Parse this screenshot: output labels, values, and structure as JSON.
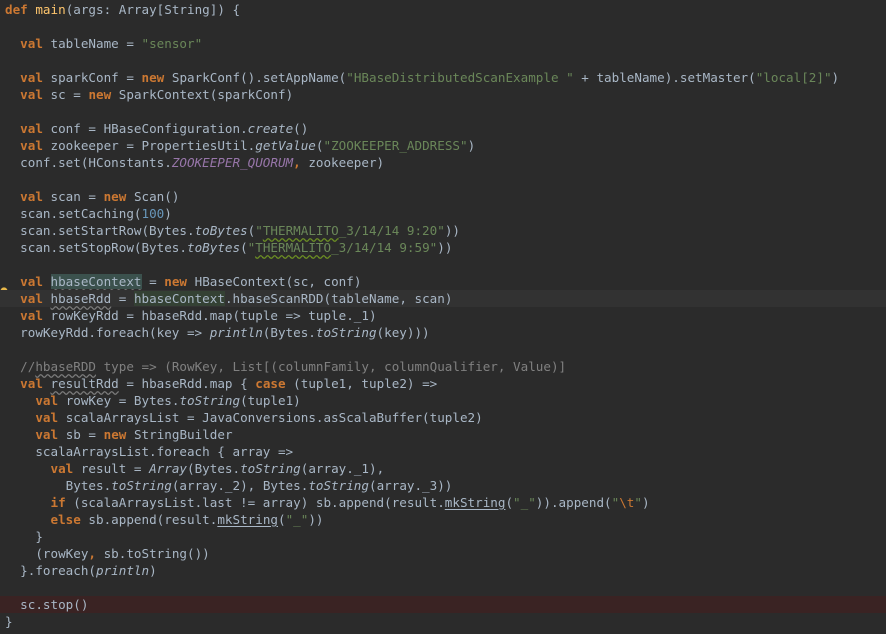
{
  "editor": {
    "language": "scala",
    "intention_icon": "lightbulb-icon",
    "colors": {
      "background": "#2b2b2b",
      "keyword": "#cc7832",
      "string": "#6a8759",
      "number": "#6897bb",
      "function_name": "#ffc66d",
      "constant": "#9876aa",
      "comment": "#808080",
      "text": "#a9b7c6",
      "breakpoint_line": "#3a2323"
    },
    "lines": [
      {
        "segs": [
          [
            "kw",
            "def "
          ],
          [
            "fn",
            "main"
          ],
          [
            "",
            "(args: Array["
          ],
          [
            "",
            "String"
          ],
          [
            "",
            "]) {"
          ]
        ]
      },
      {
        "segs": []
      },
      {
        "segs": [
          [
            "",
            "  "
          ],
          [
            "kw",
            "val "
          ],
          [
            "",
            "tableName = "
          ],
          [
            "str",
            "\"sensor\""
          ]
        ]
      },
      {
        "segs": []
      },
      {
        "segs": [
          [
            "",
            "  "
          ],
          [
            "kw",
            "val "
          ],
          [
            "",
            "sparkConf = "
          ],
          [
            "kw",
            "new "
          ],
          [
            "",
            "SparkConf().setAppName("
          ],
          [
            "str",
            "\"HBaseDistributedScanExample \""
          ],
          [
            "",
            " + tableName).setMaster("
          ],
          [
            "str",
            "\"local[2]\""
          ],
          [
            "",
            ")"
          ]
        ]
      },
      {
        "segs": [
          [
            "",
            "  "
          ],
          [
            "kw",
            "val "
          ],
          [
            "",
            "sc = "
          ],
          [
            "kw",
            "new "
          ],
          [
            "",
            "SparkContext(sparkConf)"
          ]
        ]
      },
      {
        "segs": []
      },
      {
        "segs": [
          [
            "",
            "  "
          ],
          [
            "kw",
            "val "
          ],
          [
            "",
            "conf = HBaseConfiguration."
          ],
          [
            "it",
            "create"
          ],
          [
            "",
            "()"
          ]
        ]
      },
      {
        "segs": [
          [
            "",
            "  "
          ],
          [
            "kw",
            "val "
          ],
          [
            "",
            "zookeeper = PropertiesUtil."
          ],
          [
            "it",
            "getValue"
          ],
          [
            "",
            "("
          ],
          [
            "str",
            "\"ZOOKEEPER_ADDRESS\""
          ],
          [
            "",
            ")"
          ]
        ]
      },
      {
        "segs": [
          [
            "",
            "  conf.set(HConstants."
          ],
          [
            "const",
            "ZOOKEEPER_QUORUM"
          ],
          [
            "kw",
            ", "
          ],
          [
            "",
            "zookeeper)"
          ]
        ]
      },
      {
        "segs": []
      },
      {
        "segs": [
          [
            "",
            "  "
          ],
          [
            "kw",
            "val "
          ],
          [
            "",
            "scan = "
          ],
          [
            "kw",
            "new "
          ],
          [
            "",
            "Scan()"
          ]
        ]
      },
      {
        "segs": [
          [
            "",
            "  scan.setCaching("
          ],
          [
            "num",
            "100"
          ],
          [
            "",
            ")"
          ]
        ]
      },
      {
        "segs": [
          [
            "",
            "  scan.setStartRow(Bytes."
          ],
          [
            "it",
            "toBytes"
          ],
          [
            "",
            "("
          ],
          [
            "str",
            "\""
          ],
          [
            "str wavy",
            "THERMALITO"
          ],
          [
            "str",
            "_3/14/14 9:20\""
          ],
          [
            "",
            "))"
          ]
        ]
      },
      {
        "segs": [
          [
            "",
            "  scan.setStopRow(Bytes."
          ],
          [
            "it",
            "toBytes"
          ],
          [
            "",
            "("
          ],
          [
            "str",
            "\""
          ],
          [
            "str wavy",
            "THERMALITO"
          ],
          [
            "str",
            "_3/14/14 9:59\""
          ],
          [
            "",
            "))"
          ]
        ]
      },
      {
        "segs": []
      },
      {
        "segs": [
          [
            "",
            "  "
          ],
          [
            "kw",
            "val "
          ],
          [
            "ref-hl2 wavy-grey",
            "hbaseContext"
          ],
          [
            "",
            " = "
          ],
          [
            "kw",
            "new "
          ],
          [
            "",
            "HBaseContext(sc, conf)"
          ]
        ]
      },
      {
        "segs": [
          [
            "",
            "  "
          ],
          [
            "kw",
            "val "
          ],
          [
            "wavy-grey",
            "hbaseRdd"
          ],
          [
            "",
            " = "
          ],
          [
            "ref-hl",
            "hbaseContext"
          ],
          [
            "",
            ".hbaseScanRDD(tableName, scan)"
          ]
        ],
        "current": true
      },
      {
        "segs": [
          [
            "",
            "  "
          ],
          [
            "kw",
            "val "
          ],
          [
            "",
            "rowKeyRdd = hbaseRdd.map(tuple => tuple._1)"
          ]
        ]
      },
      {
        "segs": [
          [
            "",
            "  rowKeyRdd.foreach(key => "
          ],
          [
            "it",
            "println"
          ],
          [
            "",
            "(Bytes."
          ],
          [
            "it",
            "toString"
          ],
          [
            "",
            "(key)))"
          ]
        ]
      },
      {
        "segs": []
      },
      {
        "segs": [
          [
            "cmt",
            "  //"
          ],
          [
            "cmt wavy-grey",
            "hbaseRDD"
          ],
          [
            "cmt",
            " type => (RowKey, List[(columnFamily, columnQualifier, Value)]"
          ]
        ]
      },
      {
        "segs": [
          [
            "",
            "  "
          ],
          [
            "kw",
            "val "
          ],
          [
            "wavy-grey",
            "resultRdd"
          ],
          [
            "",
            " = hbaseRdd.map { "
          ],
          [
            "kw",
            "case "
          ],
          [
            "",
            "(tuple1, tuple2) =>"
          ]
        ]
      },
      {
        "segs": [
          [
            "",
            "    "
          ],
          [
            "kw",
            "val "
          ],
          [
            "",
            "rowKey = Bytes."
          ],
          [
            "it",
            "toString"
          ],
          [
            "",
            "(tuple1)"
          ]
        ]
      },
      {
        "segs": [
          [
            "",
            "    "
          ],
          [
            "kw",
            "val "
          ],
          [
            "",
            "scalaArraysList = JavaConversions.asScalaBuffer(tuple2)"
          ]
        ]
      },
      {
        "segs": [
          [
            "",
            "    "
          ],
          [
            "kw",
            "val "
          ],
          [
            "",
            "sb = "
          ],
          [
            "kw",
            "new "
          ],
          [
            "",
            "StringBuilder"
          ]
        ]
      },
      {
        "segs": [
          [
            "",
            "    scalaArraysList.foreach { array =>"
          ]
        ]
      },
      {
        "segs": [
          [
            "",
            "      "
          ],
          [
            "kw",
            "val "
          ],
          [
            "",
            "result = "
          ],
          [
            "it",
            "Array"
          ],
          [
            "",
            "(Bytes."
          ],
          [
            "it",
            "toString"
          ],
          [
            "",
            "(array._1),"
          ]
        ]
      },
      {
        "segs": [
          [
            "",
            "        Bytes."
          ],
          [
            "it",
            "toString"
          ],
          [
            "",
            "(array._2), Bytes."
          ],
          [
            "it",
            "toString"
          ],
          [
            "",
            "(array._3))"
          ]
        ]
      },
      {
        "segs": [
          [
            "",
            "      "
          ],
          [
            "kw",
            "if "
          ],
          [
            "",
            "(scalaArraysList.last != array) sb.append(result."
          ],
          [
            "under",
            "mkString"
          ],
          [
            "",
            "("
          ],
          [
            "str",
            "\"_\""
          ],
          [
            "",
            ")).append("
          ],
          [
            "str",
            "\""
          ],
          [
            "esc",
            "\\t"
          ],
          [
            "str",
            "\""
          ],
          [
            "",
            ")"
          ]
        ]
      },
      {
        "segs": [
          [
            "",
            "      "
          ],
          [
            "kw",
            "else "
          ],
          [
            "",
            "sb.append(result."
          ],
          [
            "under",
            "mkString"
          ],
          [
            "",
            "("
          ],
          [
            "str",
            "\"_\""
          ],
          [
            "",
            "))"
          ]
        ]
      },
      {
        "segs": [
          [
            "",
            "    }"
          ]
        ]
      },
      {
        "segs": [
          [
            "",
            "    (rowKey"
          ],
          [
            "kw",
            ", "
          ],
          [
            "",
            "sb.toString())"
          ]
        ]
      },
      {
        "segs": [
          [
            "",
            "  }.foreach("
          ],
          [
            "it",
            "println"
          ],
          [
            "",
            ")"
          ]
        ]
      },
      {
        "segs": []
      },
      {
        "segs": [
          [
            "",
            "  sc.stop()"
          ]
        ],
        "breakpoint": true
      },
      {
        "segs": [
          [
            "",
            "}"
          ]
        ]
      }
    ]
  }
}
